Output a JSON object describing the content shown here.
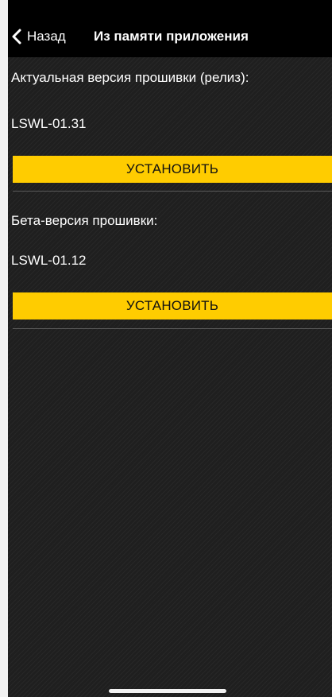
{
  "header": {
    "back_label": "Назад",
    "title": "Из памяти приложения"
  },
  "release": {
    "heading": "Актуальная версия прошивки (релиз):",
    "version": "LSWL-01.31",
    "install_label": "УСТАНОВИТЬ"
  },
  "beta": {
    "heading": "Бета-версия прошивки:",
    "version": "LSWL-01.12",
    "install_label": "УСТАНОВИТЬ"
  },
  "colors": {
    "accent": "#ffcc00",
    "background": "#1f1f1f",
    "header": "#000000"
  }
}
